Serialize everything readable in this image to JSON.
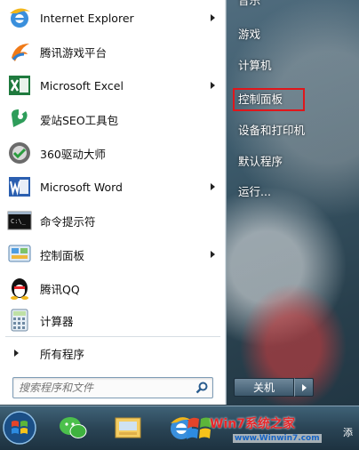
{
  "programs": [
    {
      "label": "Internet Explorer",
      "has_arrow": true,
      "icon": "internet-explorer-icon"
    },
    {
      "label": "腾讯游戏平台",
      "has_arrow": false,
      "icon": "tencent-games-icon"
    },
    {
      "label": "Microsoft Excel",
      "has_arrow": true,
      "icon": "excel-icon"
    },
    {
      "label": "爱站SEO工具包",
      "has_arrow": false,
      "icon": "aizhan-seo-icon"
    },
    {
      "label": "360驱动大师",
      "has_arrow": false,
      "icon": "driver-master-icon"
    },
    {
      "label": "Microsoft Word",
      "has_arrow": true,
      "icon": "word-icon"
    },
    {
      "label": "命令提示符",
      "has_arrow": false,
      "icon": "command-prompt-icon"
    },
    {
      "label": "控制面板",
      "has_arrow": true,
      "icon": "control-panel-icon"
    },
    {
      "label": "腾讯QQ",
      "has_arrow": false,
      "icon": "qq-penguin-icon"
    },
    {
      "label": "计算器",
      "has_arrow": false,
      "icon": "calculator-icon"
    }
  ],
  "all_programs": "所有程序",
  "search": {
    "placeholder": "搜索程序和文件"
  },
  "right_links": {
    "top_partial": "音乐",
    "games": "游戏",
    "computer": "计算机",
    "control_panel": "控制面板",
    "devices_printers": "设备和打印机",
    "default_programs": "默认程序",
    "run": "运行..."
  },
  "shutdown": "关机",
  "taskbar": {
    "watermark": "Win7系统之家",
    "watermark_url": "www.Winwin7.com",
    "tray": "添"
  },
  "colors": {
    "highlight_border": "#e0161b"
  }
}
